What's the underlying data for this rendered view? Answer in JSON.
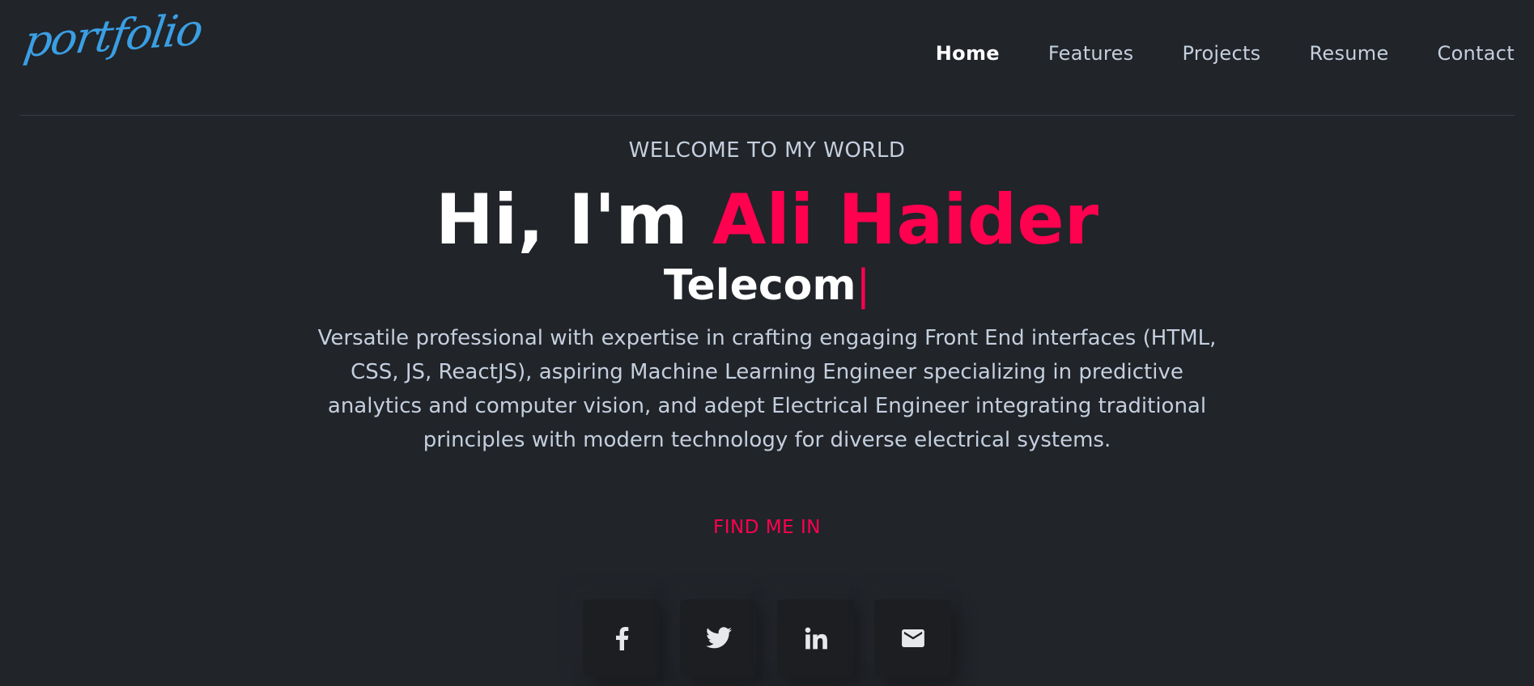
{
  "nav": {
    "logo": "portfolio",
    "links": [
      {
        "label": "Home",
        "active": true
      },
      {
        "label": "Features",
        "active": false
      },
      {
        "label": "Projects",
        "active": false
      },
      {
        "label": "Resume",
        "active": false
      },
      {
        "label": "Contact",
        "active": false
      }
    ]
  },
  "hero": {
    "welcome": "WELCOME TO MY WORLD",
    "greeting": "Hi, I'm ",
    "name": "Ali Haider",
    "role": "Telecom",
    "cursor": "|",
    "description": "Versatile professional with expertise in crafting engaging Front End interfaces (HTML, CSS, JS, ReactJS), aspiring Machine Learning Engineer specializing in predictive analytics and computer vision, and adept Electrical Engineer integrating traditional principles with modern technology for diverse electrical systems.",
    "find_me": "FIND ME IN"
  },
  "socials": [
    {
      "icon": "facebook-icon"
    },
    {
      "icon": "twitter-icon"
    },
    {
      "icon": "linkedin-icon"
    },
    {
      "icon": "email-icon"
    }
  ],
  "colors": {
    "background": "#212429",
    "accent": "#ff014f",
    "logo": "#3a9fe3",
    "text": "#c4cfde"
  }
}
